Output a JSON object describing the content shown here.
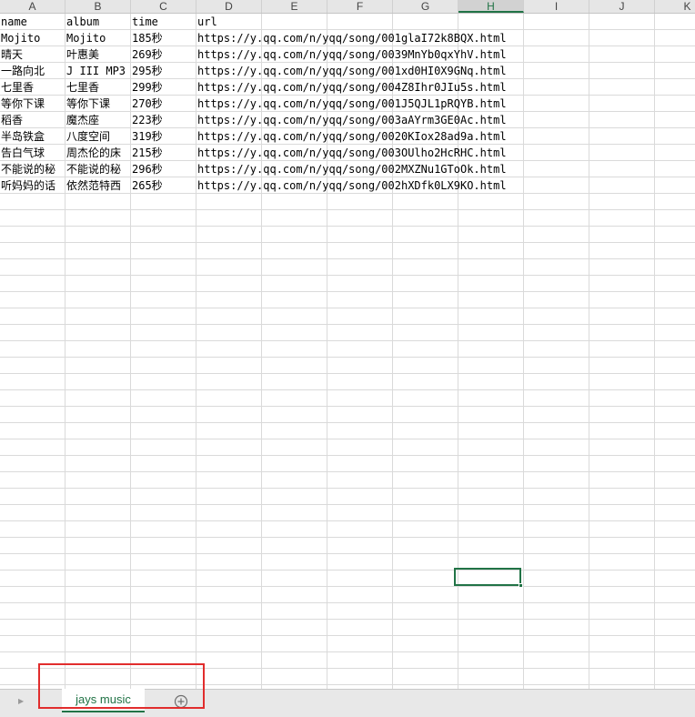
{
  "columns": [
    "A",
    "B",
    "C",
    "D",
    "E",
    "F",
    "G",
    "H",
    "I",
    "J",
    "K"
  ],
  "selected_column": "H",
  "rows": [
    [
      "name",
      "album",
      "time",
      "url"
    ],
    [
      "Mojito",
      "Mojito",
      "185秒",
      "https://y.qq.com/n/yqq/song/001glaI72k8BQX.html"
    ],
    [
      "晴天",
      "叶惠美",
      "269秒",
      "https://y.qq.com/n/yqq/song/0039MnYb0qxYhV.html"
    ],
    [
      "一路向北",
      "J III MP3",
      "295秒",
      "https://y.qq.com/n/yqq/song/001xd0HI0X9GNq.html"
    ],
    [
      "七里香",
      "七里香",
      "299秒",
      "https://y.qq.com/n/yqq/song/004Z8Ihr0JIu5s.html"
    ],
    [
      "等你下课",
      "等你下课",
      "270秒",
      "https://y.qq.com/n/yqq/song/001J5QJL1pRQYB.html"
    ],
    [
      "稻香",
      "魔杰座",
      "223秒",
      "https://y.qq.com/n/yqq/song/003aAYrm3GE0Ac.html"
    ],
    [
      "半岛铁盒",
      "八度空间",
      "319秒",
      "https://y.qq.com/n/yqq/song/0020KIox28ad9a.html"
    ],
    [
      "告白气球",
      "周杰伦的床",
      "215秒",
      "https://y.qq.com/n/yqq/song/003OUlho2HcRHC.html"
    ],
    [
      "不能说的秘",
      "不能说的秘",
      "296秒",
      "https://y.qq.com/n/yqq/song/002MXZNu1GToOk.html"
    ],
    [
      "听妈妈的话",
      "依然范特西",
      "265秒",
      "https://y.qq.com/n/yqq/song/002hXDfk0LX9KO.html"
    ]
  ],
  "sheet_tab": {
    "label": "jays music"
  },
  "icons": {
    "nav": "scroll-left-arrow-icon",
    "add": "add-sheet-icon"
  },
  "colors": {
    "accent": "#217346",
    "highlight": "#e12d2d",
    "gridline": "#dadada"
  }
}
